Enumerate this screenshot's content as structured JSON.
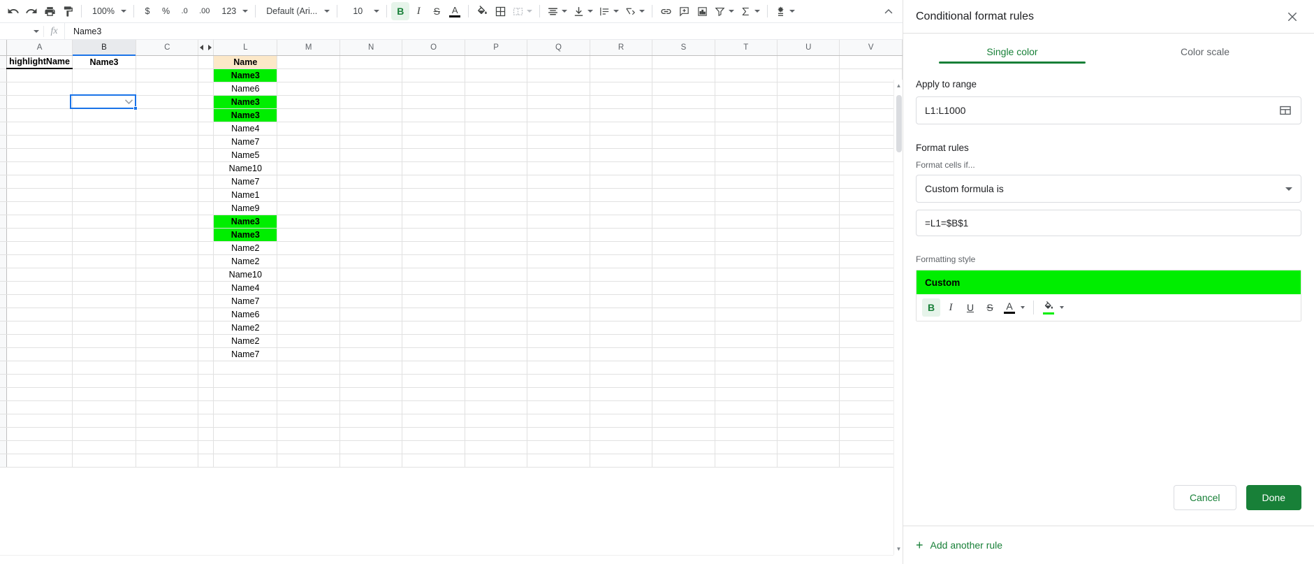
{
  "toolbar": {
    "undo_label": "undo-icon",
    "redo_label": "redo-icon",
    "print_label": "print-icon",
    "paint_label": "paint-format-icon",
    "zoom_value": "100%",
    "currency_label": "$",
    "percent_label": "%",
    "dec_decrease_label": ".0",
    "dec_increase_label": ".00",
    "number_format_label": "123",
    "font_family": "Default (Ari...",
    "font_size": "10",
    "bold_label": "B",
    "italic_label": "I",
    "strikethrough_label": "S",
    "text_color_label": "A",
    "fill_color_label": "fill-color-icon",
    "borders_label": "borders-icon",
    "merge_label": "merge-cells-icon",
    "halign_label": "horizontal-align-icon",
    "valign_label": "vertical-align-icon",
    "wrap_label": "text-wrap-icon",
    "rotate_label": "text-rotation-icon",
    "link_label": "insert-link-icon",
    "comment_label": "insert-comment-icon",
    "chart_label": "insert-chart-icon",
    "filter_label": "filter-icon",
    "functions_label": "functions-icon",
    "explore_label": "explore-icon",
    "collapse_label": "collapse-menus-icon"
  },
  "formula_bar": {
    "name_box": "",
    "fx": "fx",
    "value": "Name3"
  },
  "grid": {
    "columns": [
      "A",
      "B",
      "C",
      "L",
      "M",
      "N",
      "O",
      "P",
      "Q",
      "R",
      "S",
      "T",
      "U",
      "V"
    ],
    "selected_column": "B",
    "nav_left": "scroll-left-icon",
    "nav_right": "scroll-right-icon",
    "cell_A1": "highlightName",
    "cell_B1": "Name3",
    "column_L_header": "Name",
    "column_L_values": [
      "Name3",
      "Name6",
      "Name3",
      "Name3",
      "Name4",
      "Name7",
      "Name5",
      "Name10",
      "Name7",
      "Name1",
      "Name9",
      "Name3",
      "Name3",
      "Name2",
      "Name2",
      "Name10",
      "Name4",
      "Name7",
      "Name6",
      "Name2",
      "Name2",
      "Name7"
    ],
    "column_L_highlighted": [
      true,
      false,
      true,
      true,
      false,
      false,
      false,
      false,
      false,
      false,
      false,
      true,
      true,
      false,
      false,
      false,
      false,
      false,
      false,
      false,
      false,
      false
    ],
    "highlight_color": "#00ee00",
    "header_fill_color": "#fce8c8",
    "selection_color": "#1a73e8",
    "empty_rows_after": 8
  },
  "panel": {
    "title": "Conditional format rules",
    "close_label": "close-icon",
    "tabs": [
      {
        "label": "Single color",
        "active": true
      },
      {
        "label": "Color scale",
        "active": false
      }
    ],
    "apply_to_range": {
      "label": "Apply to range",
      "value": "L1:L1000",
      "picker_icon": "select-data-range-icon"
    },
    "format_rules": {
      "label": "Format rules",
      "sub_label": "Format cells if...",
      "condition": "Custom formula is",
      "formula": "=L1=$B$1"
    },
    "formatting_style": {
      "label": "Formatting style",
      "preview_text": "Custom",
      "preview_bg": "#00ee00",
      "preview_fg": "#000000",
      "bold_label": "B",
      "italic_label": "I",
      "underline_label": "U",
      "strikethrough_label": "S",
      "text_color_label": "A",
      "text_color_value": "#000000",
      "fill_color_label": "fill-color-icon",
      "fill_color_value": "#00ee00"
    },
    "actions": {
      "cancel_label": "Cancel",
      "done_label": "Done"
    },
    "add_rule_label": "Add another rule",
    "add_rule_plus": "+",
    "accent_color": "#188038"
  }
}
